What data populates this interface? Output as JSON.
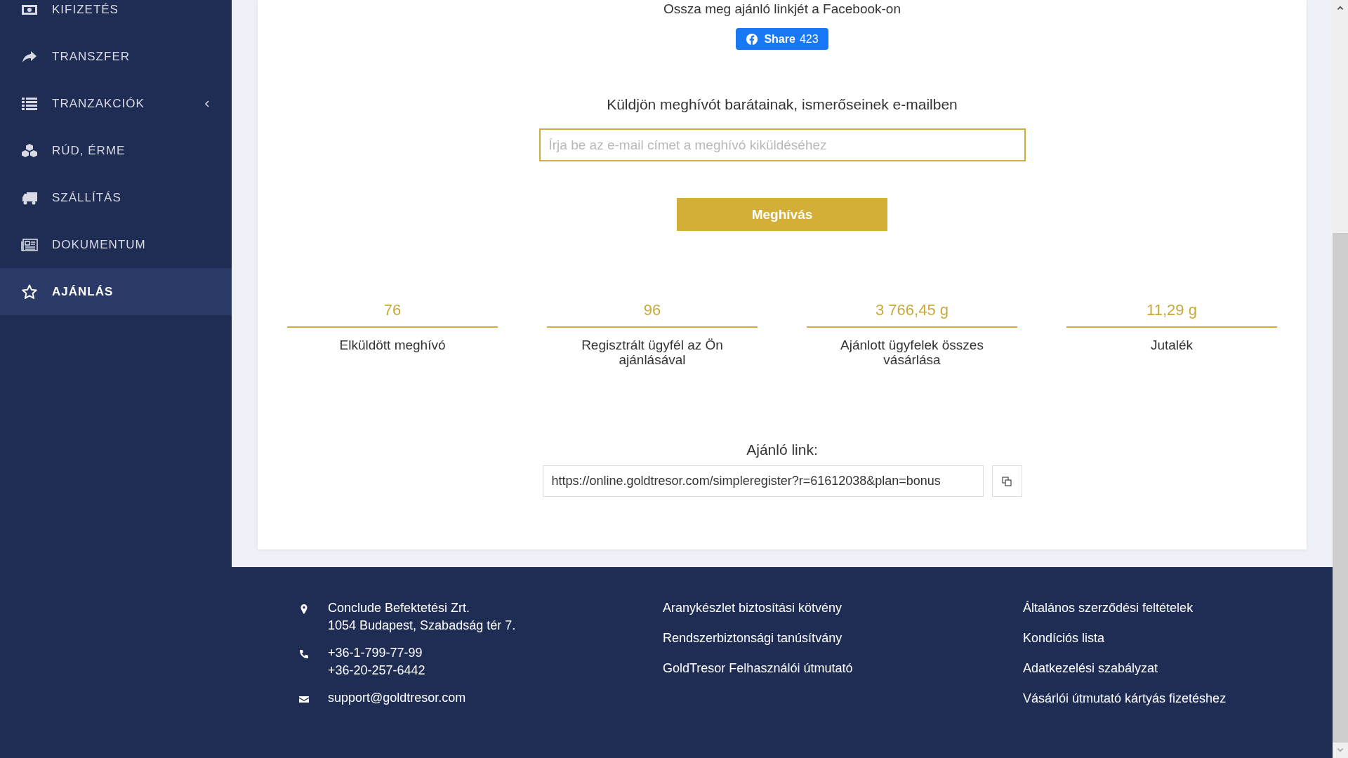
{
  "sidebar": {
    "items": [
      {
        "label": "KIFIZETÉS",
        "selected": false,
        "expandable": false
      },
      {
        "label": "TRANSZFER",
        "selected": false,
        "expandable": false
      },
      {
        "label": "TRANZAKCIÓK",
        "selected": false,
        "expandable": true
      },
      {
        "label": "RÚD, ÉRME",
        "selected": false,
        "expandable": false
      },
      {
        "label": "SZÁLLÍTÁS",
        "selected": false,
        "expandable": false
      },
      {
        "label": "DOKUMENTUM",
        "selected": false,
        "expandable": false
      },
      {
        "label": "AJÁNLÁS",
        "selected": true,
        "expandable": false
      }
    ]
  },
  "facebook": {
    "heading": "Ossza meg ajánló linkjét a Facebook-on",
    "share_label": "Share",
    "share_count": "423"
  },
  "invite": {
    "heading": "Küldjön meghívót barátainak, ismerőseinek e-mailben",
    "placeholder": "Írja be az e-mail címet a meghívó kiküldéséhez",
    "button": "Meghívás"
  },
  "stats": [
    {
      "value": "76",
      "label": "Elküldött meghívó"
    },
    {
      "value": "96",
      "label": "Regisztrált ügyfél az Ön ajánlásával"
    },
    {
      "value": "3 766,45 g",
      "label": "Ajánlott ügyfelek összes vásárlása"
    },
    {
      "value": "11,29 g",
      "label": "Jutalék"
    }
  ],
  "referral": {
    "label": "Ajánló link:",
    "url": "https://online.goldtresor.com/simpleregister?r=61612038&plan=bonus"
  },
  "footer": {
    "contact": [
      {
        "kind": "address",
        "lines": [
          "Conclude Befektetési Zrt.",
          "1054 Budapest, Szabadság tér 7."
        ]
      },
      {
        "kind": "phone",
        "lines": [
          "+36-1-799-77-99",
          "+36-20-257-6442"
        ]
      },
      {
        "kind": "email",
        "lines": [
          "support@goldtresor.com"
        ]
      }
    ],
    "links_1": [
      "Aranykészlet biztosítási kötvény",
      "Rendszerbiztonsági tanúsítvány",
      "GoldTresor Felhasználói útmutató"
    ],
    "links_2": [
      "Általános szerződési feltételek",
      "Kondíciós lista",
      "Adatkezelési szabályzat",
      "Vásárlói útmutató kártyás fizetéshez"
    ]
  }
}
